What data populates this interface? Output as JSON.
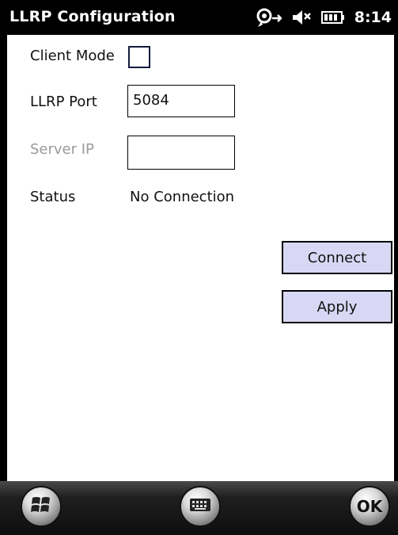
{
  "app": {
    "title": "LLRP Configuration",
    "time": "8:14"
  },
  "status_icons": [
    "connectivity-icon",
    "speaker-muted-icon",
    "battery-icon"
  ],
  "form": {
    "client_mode_label": "Client Mode",
    "client_mode_checked": false,
    "llrp_port_label": "LLRP Port",
    "llrp_port_value": "5084",
    "server_ip_label": "Server IP",
    "server_ip_value": "",
    "status_label": "Status",
    "status_value": "No Connection"
  },
  "buttons": {
    "connect": "Connect",
    "apply": "Apply"
  },
  "bottom_bar": {
    "start": "windows-start-icon",
    "keyboard": "keyboard-icon",
    "ok_label": "OK"
  },
  "colors": {
    "titlebar": "#000000",
    "button_fill": "#d8d8f4",
    "disabled_text": "#9a9a9a"
  }
}
